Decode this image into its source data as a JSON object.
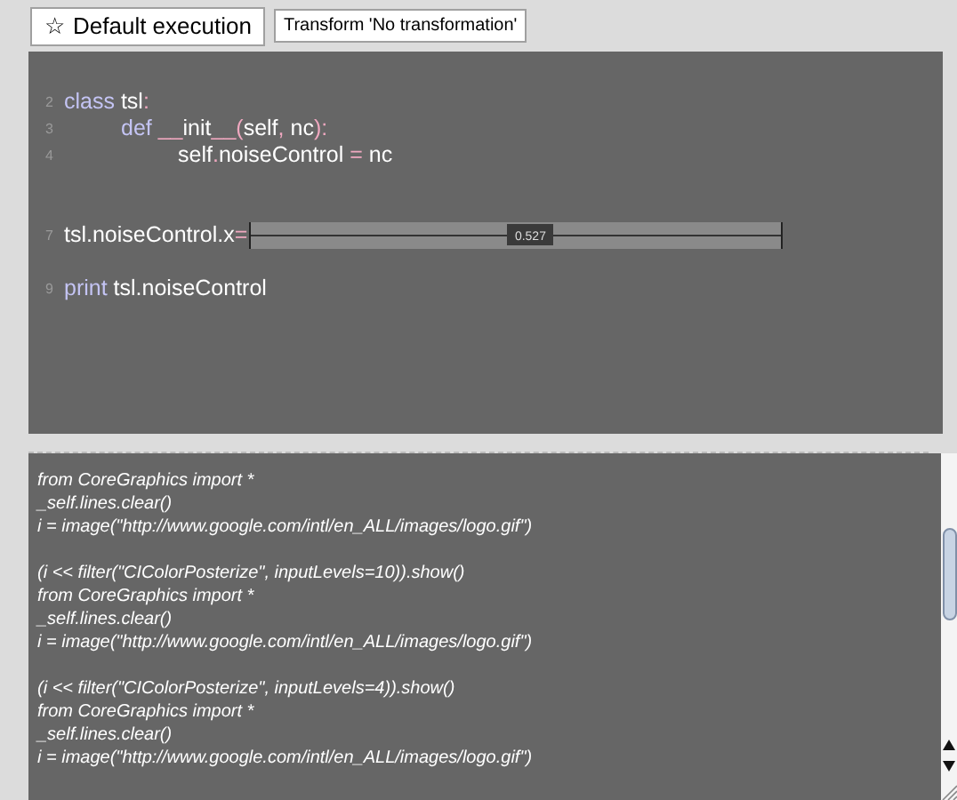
{
  "toolbar": {
    "buttons": [
      {
        "icon": "☆",
        "label": "Default execution",
        "kind": "large"
      },
      {
        "label": "Transform 'No transformation'",
        "kind": "small"
      }
    ]
  },
  "editor": {
    "lines": [
      {
        "number": "2",
        "segments": [
          {
            "text": "class",
            "kind": "keyword"
          },
          {
            "text": " tsl",
            "kind": "plain"
          },
          {
            "text": ":",
            "kind": "punct"
          }
        ],
        "children": [
          {
            "number": "3",
            "segments": [
              {
                "text": "def ",
                "kind": "keyword"
              },
              {
                "text": "__",
                "kind": "punct"
              },
              {
                "text": "init",
                "kind": "plain"
              },
              {
                "text": "__",
                "kind": "punct"
              },
              {
                "text": "(",
                "kind": "punct"
              },
              {
                "text": "self",
                "kind": "plain"
              },
              {
                "text": ",",
                "kind": "punct"
              },
              {
                "text": " nc",
                "kind": "plain"
              },
              {
                "text": "):",
                "kind": "punct"
              }
            ],
            "children": [
              {
                "number": "4",
                "segments": [
                  {
                    "text": "self",
                    "kind": "plain"
                  },
                  {
                    "text": ".",
                    "kind": "punct"
                  },
                  {
                    "text": "noiseControl ",
                    "kind": "plain"
                  },
                  {
                    "text": "=",
                    "kind": "punct"
                  },
                  {
                    "text": " nc",
                    "kind": "plain"
                  }
                ]
              }
            ]
          }
        ]
      },
      {
        "number": "7",
        "segments": [
          {
            "text": "tsl.noiseControl.x",
            "kind": "plain"
          },
          {
            "text": "=",
            "kind": "punct"
          }
        ],
        "slider": {
          "level": 0.527,
          "reading": "0.527"
        }
      },
      {
        "number": "9",
        "segments": [
          {
            "text": "print",
            "kind": "keyword"
          },
          {
            "text": " tsl.noiseControl",
            "kind": "plain"
          }
        ]
      }
    ]
  },
  "output": {
    "blocks": [
      [
        "from CoreGraphics import *",
        "_self.lines.clear()",
        "i = image(\"http://www.google.com/intl/en_ALL/images/logo.gif\")"
      ],
      [
        "(i << filter(\"CIColorPosterize\", inputLevels=10)).show()",
        "from CoreGraphics import *",
        "_self.lines.clear()",
        "i = image(\"http://www.google.com/intl/en_ALL/images/logo.gif\")"
      ],
      [
        "(i << filter(\"CIColorPosterize\", inputLevels=4)).show()",
        "from CoreGraphics import *",
        "_self.lines.clear()",
        "i = image(\"http://www.google.com/intl/en_ALL/images/logo.gif\")"
      ]
    ]
  }
}
